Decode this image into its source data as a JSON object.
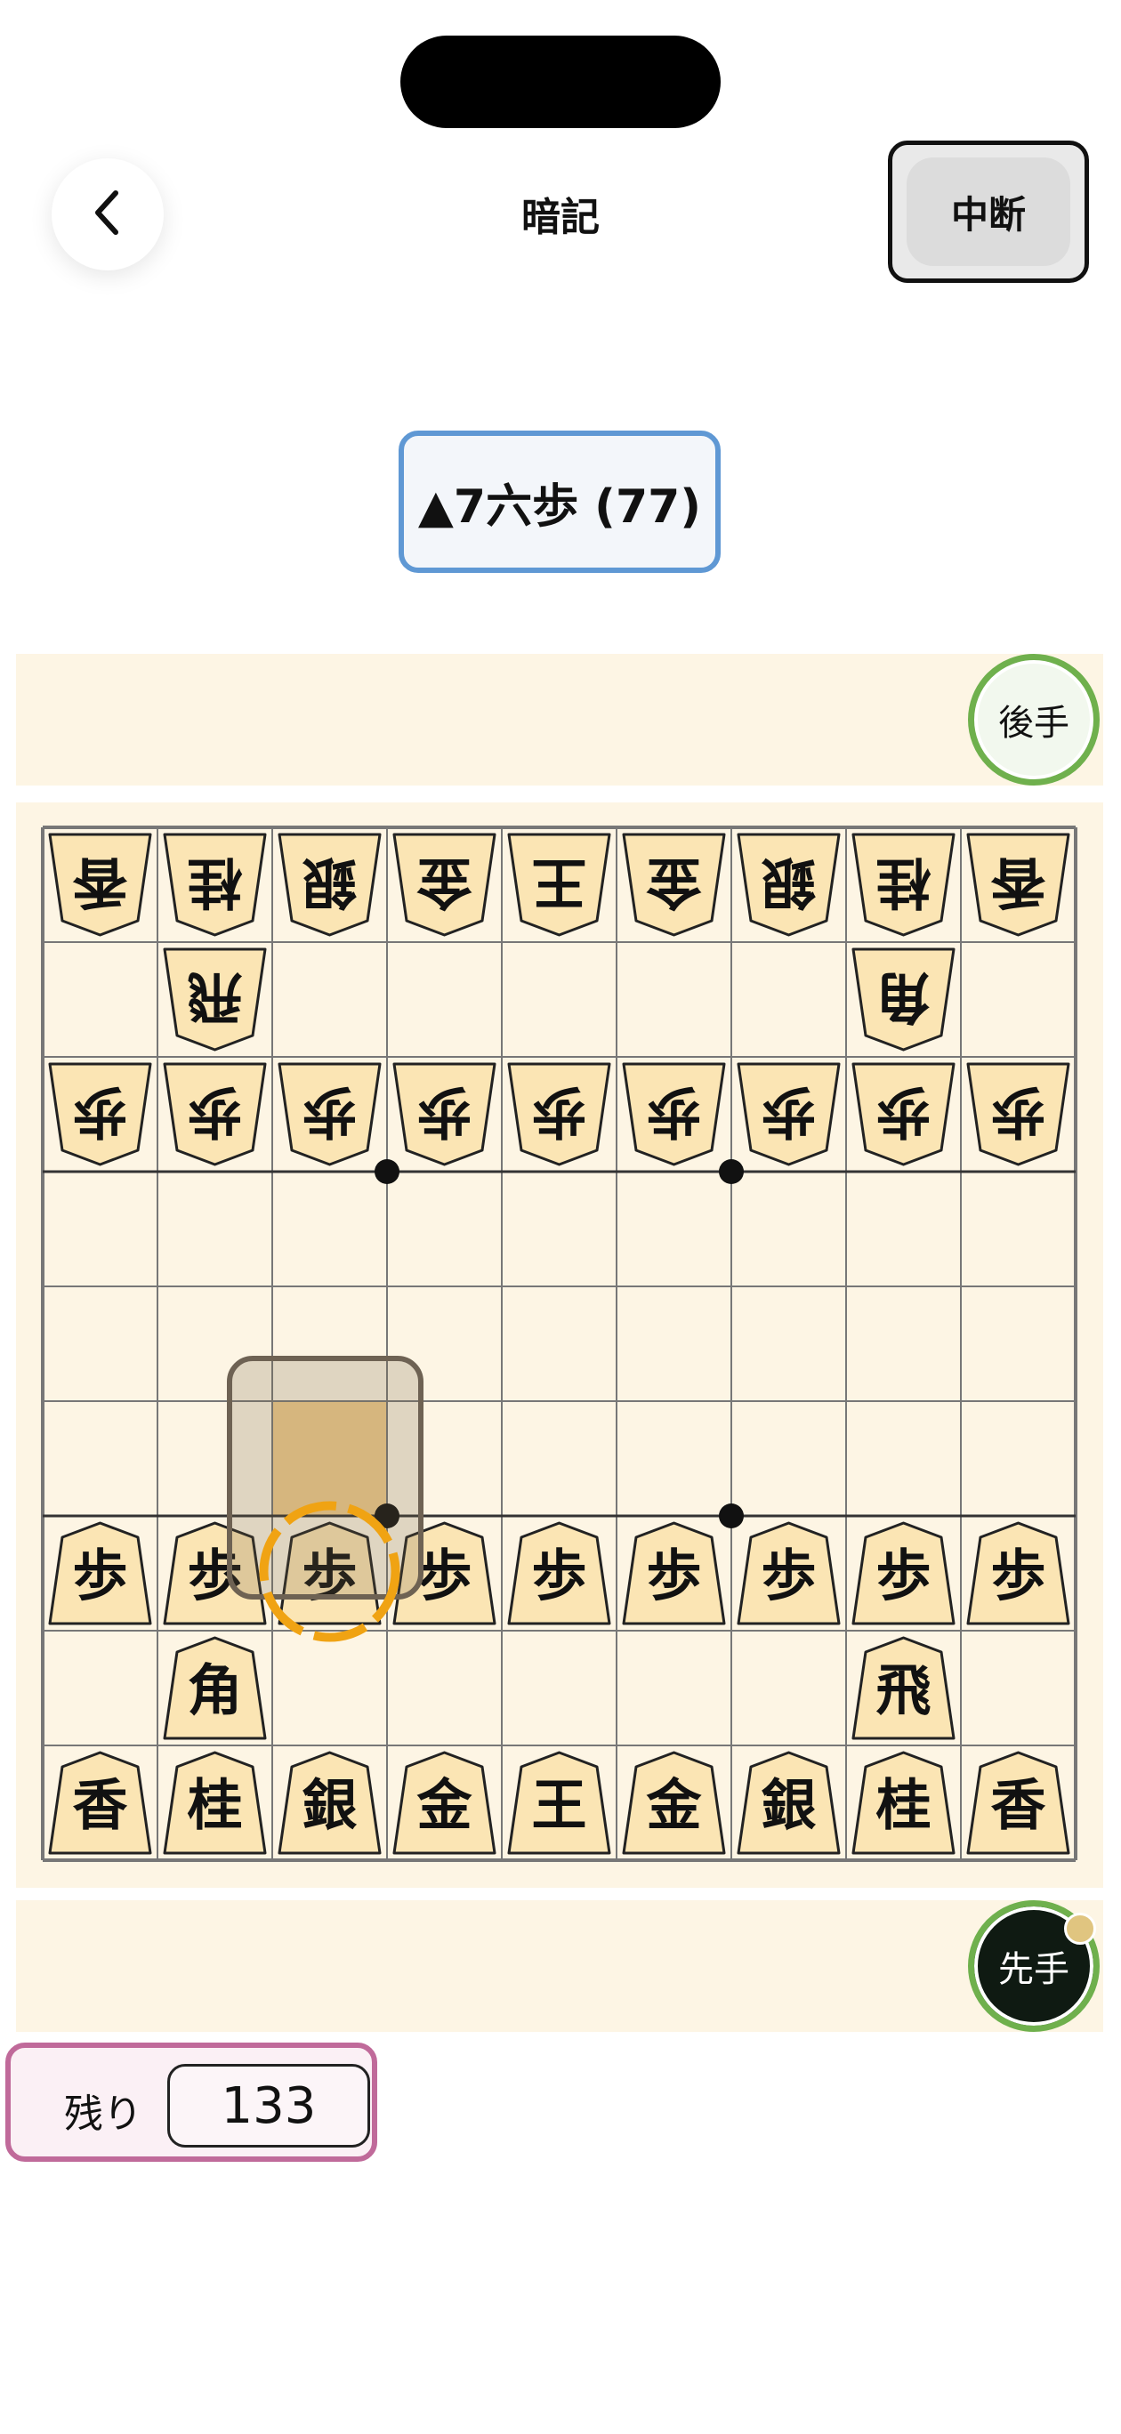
{
  "header": {
    "title": "暗記",
    "pause_label": "中断",
    "back_icon": "chevron-left-icon"
  },
  "move": {
    "notation": "▲7六歩 (77)"
  },
  "players": {
    "gote": "後手",
    "sente": "先手"
  },
  "board": {
    "rows": [
      [
        "香",
        "桂",
        "銀",
        "金",
        "王",
        "金",
        "銀",
        "桂",
        "香"
      ],
      [
        "",
        "飛",
        "",
        "",
        "",
        "",
        "",
        "角",
        ""
      ],
      [
        "歩",
        "歩",
        "歩",
        "歩",
        "歩",
        "歩",
        "歩",
        "歩",
        "歩"
      ],
      [
        "",
        "",
        "",
        "",
        "",
        "",
        "",
        "",
        ""
      ],
      [
        "",
        "",
        "",
        "",
        "",
        "",
        "",
        "",
        ""
      ],
      [
        "",
        "",
        "",
        "",
        "",
        "",
        "",
        "",
        ""
      ],
      [
        "歩",
        "歩",
        "歩",
        "歩",
        "歩",
        "歩",
        "歩",
        "歩",
        "歩"
      ],
      [
        "",
        "角",
        "",
        "",
        "",
        "",
        "",
        "飛",
        ""
      ],
      [
        "香",
        "桂",
        "銀",
        "金",
        "王",
        "金",
        "銀",
        "桂",
        "香"
      ]
    ],
    "gote_rows": [
      0,
      1,
      2
    ],
    "highlight": {
      "from_col_index": 2,
      "from_row_index": 6,
      "to_row_index": 5
    },
    "colors": {
      "board": "#fdf5e4",
      "grid": "#777777",
      "piece_fill": "#fbe5b4",
      "piece_stroke": "#222222",
      "highlight": "#f1cd8f",
      "ring": "#f0a313"
    }
  },
  "remaining": {
    "label": "残り",
    "count": "133"
  }
}
